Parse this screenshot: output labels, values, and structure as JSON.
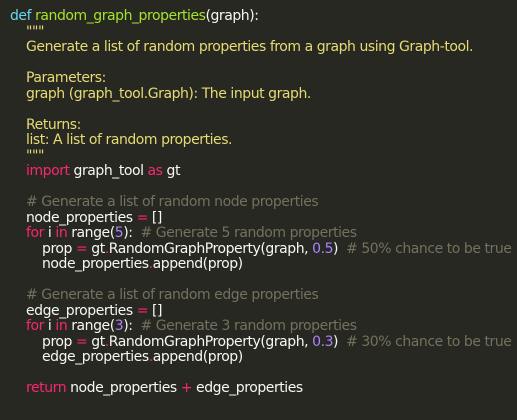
{
  "editor": {
    "theme": "monokai",
    "background": "#272822",
    "colors": {
      "keyword": "#66d9ef",
      "function": "#a6e22e",
      "string": "#e6db74",
      "control": "#f92672",
      "comment": "#75715e",
      "number": "#ae81ff",
      "text": "#f8f8f2"
    },
    "lines": [
      [
        {
          "t": "def",
          "c": "kw"
        },
        {
          "t": " ",
          "c": "txt"
        },
        {
          "t": "random_graph_properties",
          "c": "fn"
        },
        {
          "t": "(graph):",
          "c": "txt"
        }
      ],
      [
        {
          "t": "    \"\"\"",
          "c": "str"
        }
      ],
      [
        {
          "t": "    Generate a list of random properties from a graph using Graph-tool.",
          "c": "str"
        }
      ],
      [],
      [
        {
          "t": "    Parameters:",
          "c": "str"
        }
      ],
      [
        {
          "t": "    graph (graph_tool.Graph): The input graph.",
          "c": "str"
        }
      ],
      [],
      [
        {
          "t": "    Returns:",
          "c": "str"
        }
      ],
      [
        {
          "t": "    list: A list of random properties.",
          "c": "str"
        }
      ],
      [
        {
          "t": "    \"\"\"",
          "c": "str"
        }
      ],
      [
        {
          "t": "    ",
          "c": "txt"
        },
        {
          "t": "import",
          "c": "ctl"
        },
        {
          "t": " graph_tool ",
          "c": "txt"
        },
        {
          "t": "as",
          "c": "ctl"
        },
        {
          "t": " gt",
          "c": "txt"
        }
      ],
      [],
      [
        {
          "t": "    # Generate a list of random node properties",
          "c": "cmt"
        }
      ],
      [
        {
          "t": "    node_properties ",
          "c": "txt"
        },
        {
          "t": "=",
          "c": "ctl"
        },
        {
          "t": " []",
          "c": "txt"
        }
      ],
      [
        {
          "t": "    ",
          "c": "txt"
        },
        {
          "t": "for",
          "c": "ctl"
        },
        {
          "t": " i ",
          "c": "txt"
        },
        {
          "t": "in",
          "c": "ctl"
        },
        {
          "t": " range(",
          "c": "txt"
        },
        {
          "t": "5",
          "c": "num"
        },
        {
          "t": "):  ",
          "c": "txt"
        },
        {
          "t": "# Generate 5 random properties",
          "c": "cmt"
        }
      ],
      [
        {
          "t": "        prop ",
          "c": "txt"
        },
        {
          "t": "=",
          "c": "ctl"
        },
        {
          "t": " gt",
          "c": "txt"
        },
        {
          "t": ".",
          "c": "ctl"
        },
        {
          "t": "RandomGraphProperty(graph, ",
          "c": "txt"
        },
        {
          "t": "0.5",
          "c": "num"
        },
        {
          "t": ")  ",
          "c": "txt"
        },
        {
          "t": "# 50% chance to be true",
          "c": "cmt"
        }
      ],
      [
        {
          "t": "        node_properties",
          "c": "txt"
        },
        {
          "t": ".",
          "c": "ctl"
        },
        {
          "t": "append(prop)",
          "c": "txt"
        }
      ],
      [],
      [
        {
          "t": "    # Generate a list of random edge properties",
          "c": "cmt"
        }
      ],
      [
        {
          "t": "    edge_properties ",
          "c": "txt"
        },
        {
          "t": "=",
          "c": "ctl"
        },
        {
          "t": " []",
          "c": "txt"
        }
      ],
      [
        {
          "t": "    ",
          "c": "txt"
        },
        {
          "t": "for",
          "c": "ctl"
        },
        {
          "t": " i ",
          "c": "txt"
        },
        {
          "t": "in",
          "c": "ctl"
        },
        {
          "t": " range(",
          "c": "txt"
        },
        {
          "t": "3",
          "c": "num"
        },
        {
          "t": "):  ",
          "c": "txt"
        },
        {
          "t": "# Generate 3 random properties",
          "c": "cmt"
        }
      ],
      [
        {
          "t": "        prop ",
          "c": "txt"
        },
        {
          "t": "=",
          "c": "ctl"
        },
        {
          "t": " gt",
          "c": "txt"
        },
        {
          "t": ".",
          "c": "ctl"
        },
        {
          "t": "RandomGraphProperty(graph, ",
          "c": "txt"
        },
        {
          "t": "0.3",
          "c": "num"
        },
        {
          "t": ")  ",
          "c": "txt"
        },
        {
          "t": "# 30% chance to be true",
          "c": "cmt"
        }
      ],
      [
        {
          "t": "        edge_properties",
          "c": "txt"
        },
        {
          "t": ".",
          "c": "ctl"
        },
        {
          "t": "append(prop)",
          "c": "txt"
        }
      ],
      [],
      [
        {
          "t": "    ",
          "c": "txt"
        },
        {
          "t": "return",
          "c": "ctl"
        },
        {
          "t": " node_properties ",
          "c": "txt"
        },
        {
          "t": "+",
          "c": "ctl"
        },
        {
          "t": " edge_properties",
          "c": "txt"
        }
      ]
    ]
  }
}
